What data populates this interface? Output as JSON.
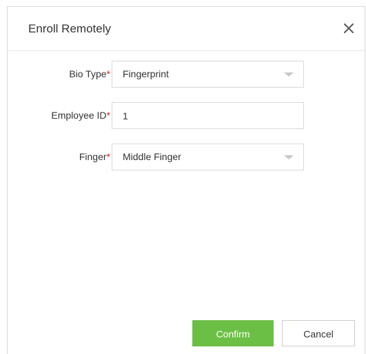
{
  "dialog": {
    "title": "Enroll Remotely",
    "close_label": "close"
  },
  "form": {
    "bio_type": {
      "label": "Bio Type",
      "required_mark": "*",
      "value": "Fingerprint"
    },
    "employee_id": {
      "label": "Employee ID",
      "required_mark": "*",
      "value": "1"
    },
    "finger": {
      "label": "Finger",
      "required_mark": "*",
      "value": "Middle Finger"
    }
  },
  "buttons": {
    "confirm_label": "Confirm",
    "cancel_label": "Cancel"
  },
  "colors": {
    "accent": "#6cbf45",
    "required": "#e02020"
  },
  "icons": {
    "close": "close-icon",
    "dropdown": "chevron-down-icon"
  }
}
